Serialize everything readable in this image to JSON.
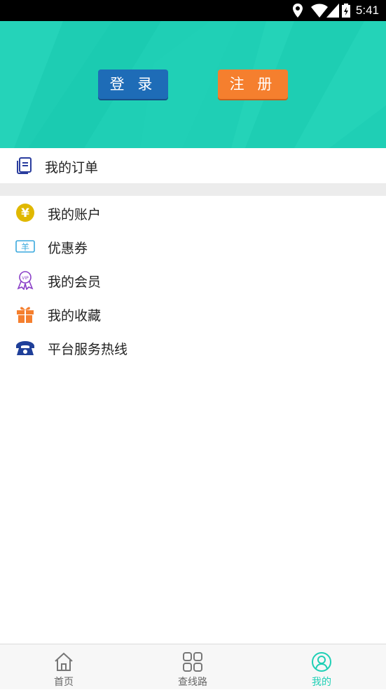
{
  "status_bar": {
    "time": "5:41",
    "icons": [
      "location-icon",
      "wifi-icon",
      "signal-icon",
      "battery-icon"
    ]
  },
  "header": {
    "background_color": "#1fcfb5",
    "login_label": "登 录",
    "register_label": "注 册",
    "login_color": "#1e6cb7",
    "register_color": "#f57f2e"
  },
  "orders": {
    "label": "我的订单",
    "icon": "document-icon"
  },
  "menu": [
    {
      "label": "我的账户",
      "icon": "yen-coin-icon"
    },
    {
      "label": "优惠券",
      "icon": "coupon-icon"
    },
    {
      "label": "我的会员",
      "icon": "vip-medal-icon"
    },
    {
      "label": "我的收藏",
      "icon": "gift-icon"
    },
    {
      "label": "平台服务热线",
      "icon": "telephone-icon"
    }
  ],
  "tabbar": {
    "tabs": [
      {
        "label": "首页",
        "icon": "home-icon",
        "active": false
      },
      {
        "label": "查线路",
        "icon": "grid-icon",
        "active": false
      },
      {
        "label": "我的",
        "icon": "user-icon",
        "active": true
      }
    ],
    "active_color": "#1fcfb5"
  }
}
